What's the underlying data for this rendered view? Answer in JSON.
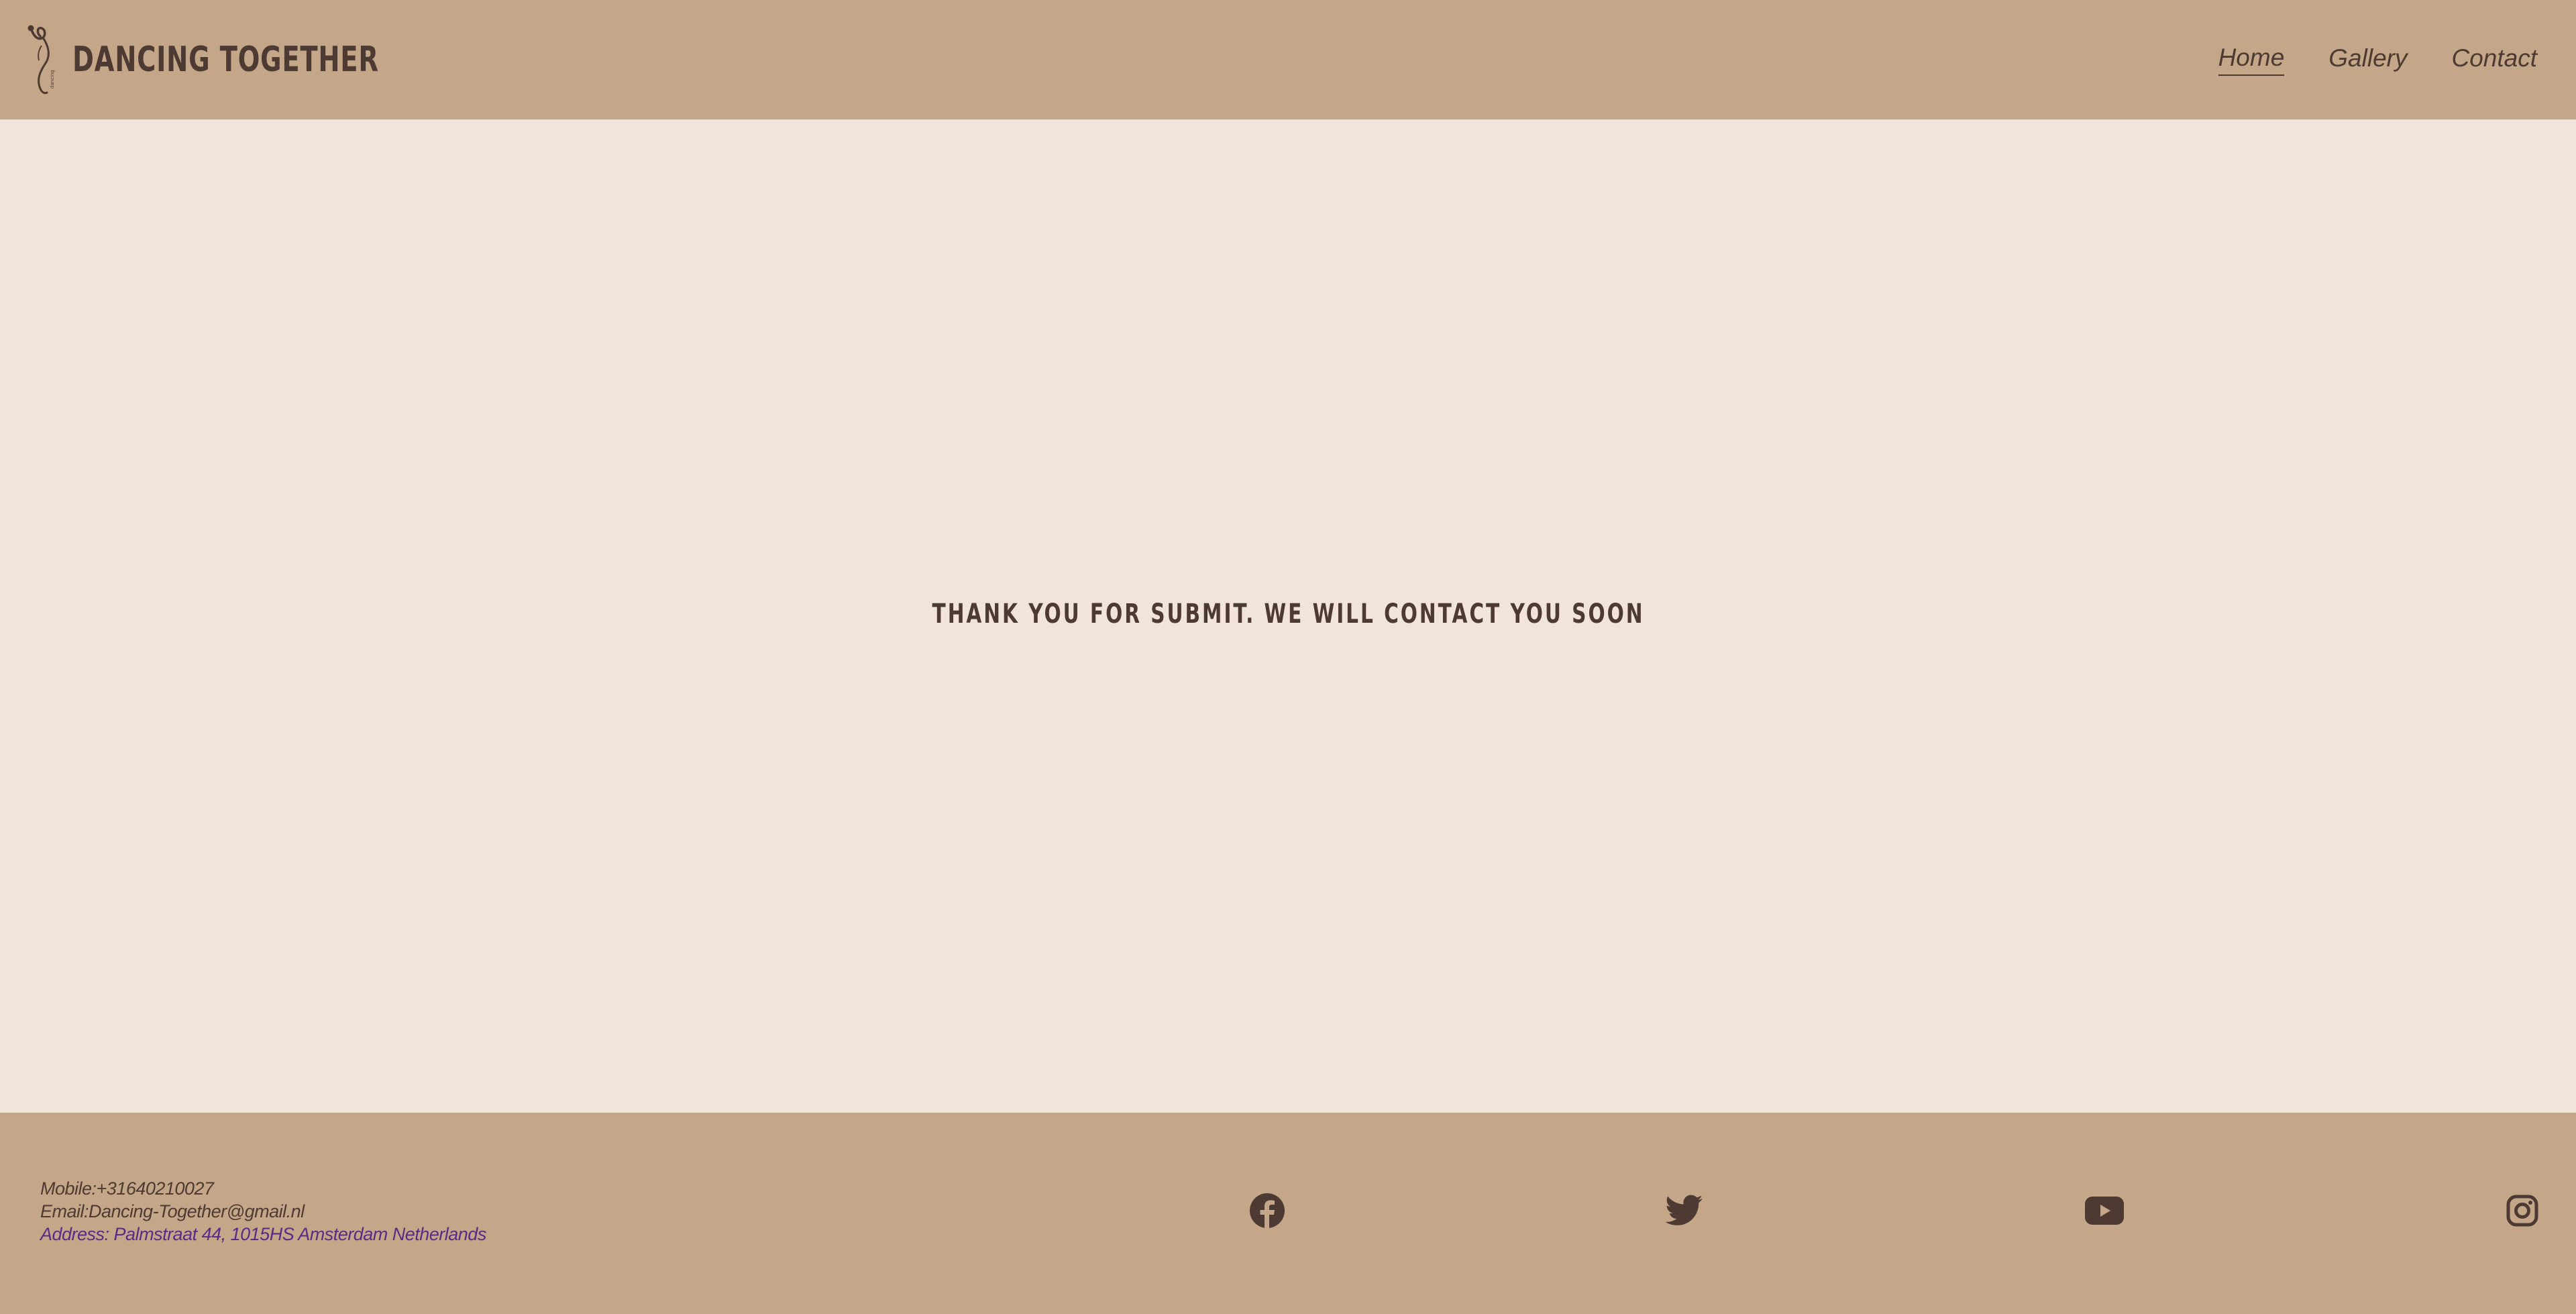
{
  "header": {
    "brand_name": "DANCING TOGETHER",
    "nav": [
      {
        "label": "Home",
        "active": true
      },
      {
        "label": "Gallery",
        "active": false
      },
      {
        "label": "Contact",
        "active": false
      }
    ]
  },
  "main": {
    "message": "THANK YOU FOR SUBMIT. WE WILL CONTACT YOU SOON"
  },
  "footer": {
    "mobile": "Mobile:+31640210027",
    "email": "Email:Dancing-Together@gmail.nl",
    "address": "Address: Palmstraat 44, 1015HS Amsterdam Netherlands",
    "social_icons": [
      "facebook-icon",
      "twitter-icon",
      "youtube-icon",
      "instagram-icon"
    ]
  },
  "colors": {
    "header_footer_bg": "#c4a688",
    "page_bg": "#f1e4da",
    "text": "#4d3b33",
    "address_link": "#5b2a86"
  }
}
